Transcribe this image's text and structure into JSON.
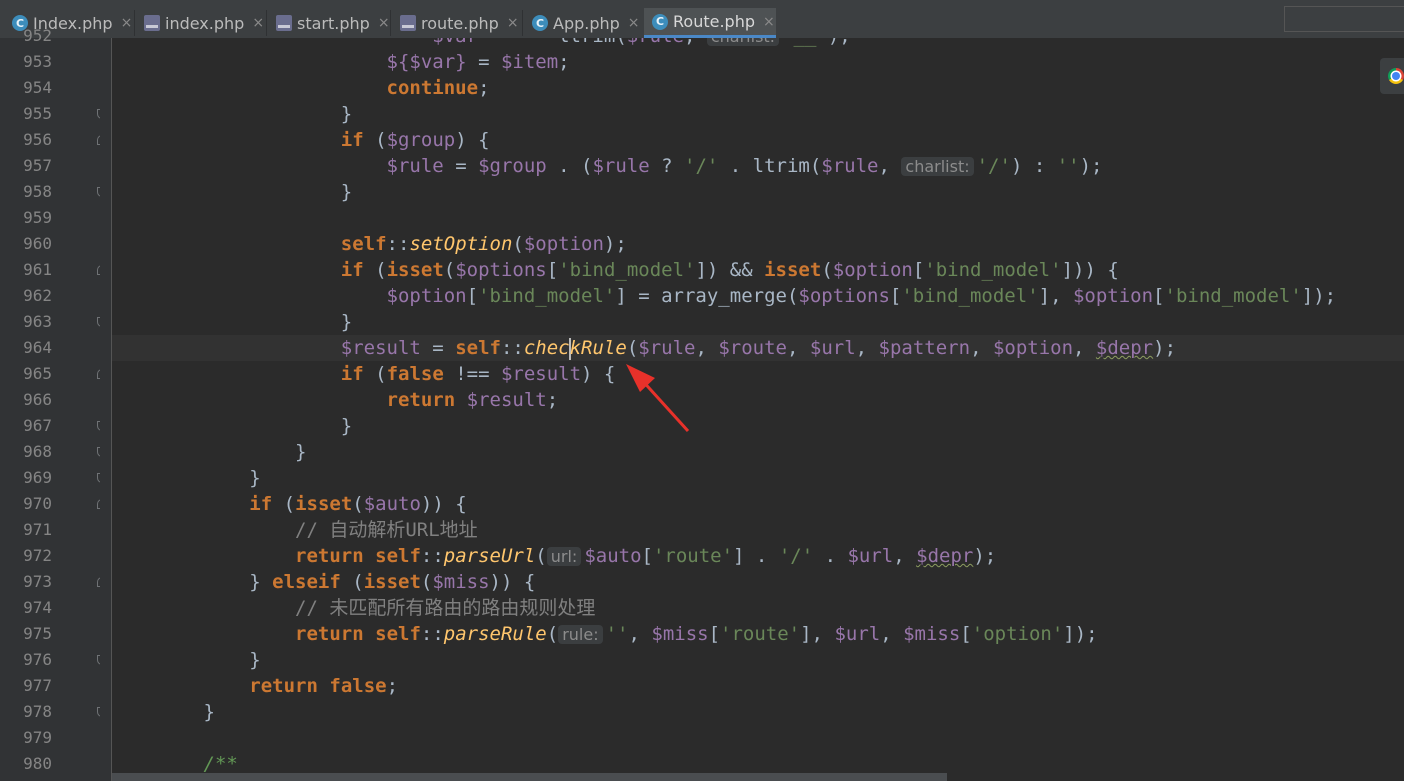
{
  "tabs": [
    {
      "label": "Index.php",
      "icon": "class-icon"
    },
    {
      "label": "index.php",
      "icon": "php-file-icon"
    },
    {
      "label": "start.php",
      "icon": "php-file-icon"
    },
    {
      "label": "route.php",
      "icon": "php-file-icon"
    },
    {
      "label": "App.php",
      "icon": "class-icon"
    },
    {
      "label": "Route.php",
      "icon": "class-icon",
      "active": true
    }
  ],
  "tab_close_glyph": "×",
  "line_numbers": [
    "952",
    "953",
    "954",
    "955",
    "956",
    "957",
    "958",
    "959",
    "960",
    "961",
    "962",
    "963",
    "964",
    "965",
    "966",
    "967",
    "968",
    "969",
    "970",
    "971",
    "972",
    "973",
    "974",
    "975",
    "976",
    "977",
    "978",
    "979",
    "980"
  ],
  "parameter_hints": {
    "line952": "charlist:",
    "line957": "charlist:",
    "line972": "url:",
    "line975": "rule:"
  },
  "comments": {
    "line971": "// 自动解析URL地址",
    "line974": "// 未匹配所有路由的路由规则处理",
    "line980": "/**"
  },
  "annotation": {
    "type": "red-arrow",
    "points_to": "checkRule",
    "color": "#e8312a"
  },
  "colors": {
    "background": "#2b2b2b",
    "gutter": "#313335",
    "keyword": "#cc7832",
    "variable": "#9876aa",
    "string": "#6a8759",
    "function": "#ffc66d",
    "comment": "#808080",
    "active_tab_underline": "#4a88c7"
  }
}
